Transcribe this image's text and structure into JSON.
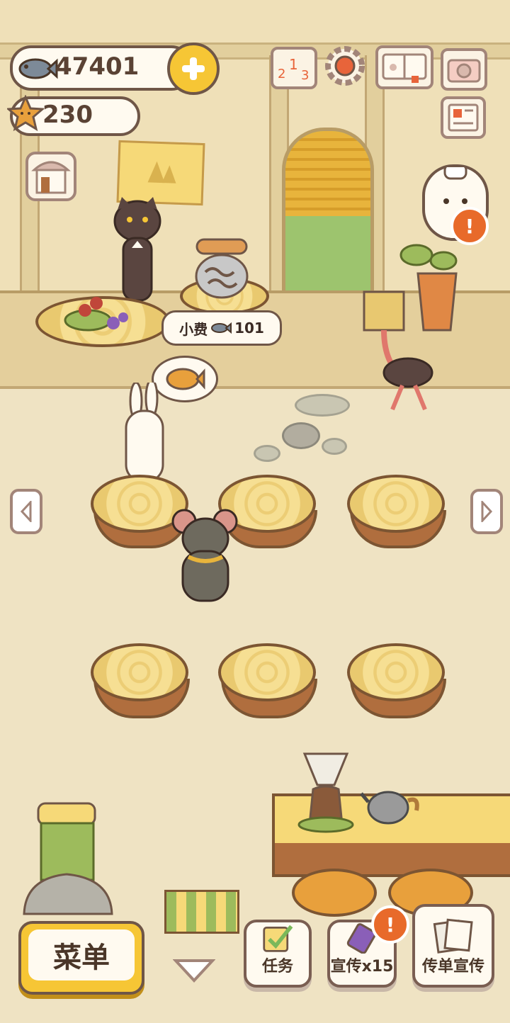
{
  "currency": {
    "fish_count": "47401",
    "star_count": "230",
    "fish_icon": "fish-icon",
    "star_icon": "star-icon",
    "add_icon": "plus-icon"
  },
  "top_icons": [
    "ranking-icon",
    "settings-gear-icon",
    "pawprint-book-icon",
    "camera-icon",
    "newspaper-icon",
    "shop-icon"
  ],
  "customer_tip": {
    "label": "小费",
    "amount": "101"
  },
  "bottom_bar": {
    "menu_label": "菜单",
    "tasks_label": "任务",
    "promote_label": "宣传x15",
    "flyer_label": "传单宣传"
  },
  "alert_mark": "!",
  "colors": {
    "accent": "#f6c635",
    "alert": "#e86a2a",
    "outline": "#6f5647"
  }
}
